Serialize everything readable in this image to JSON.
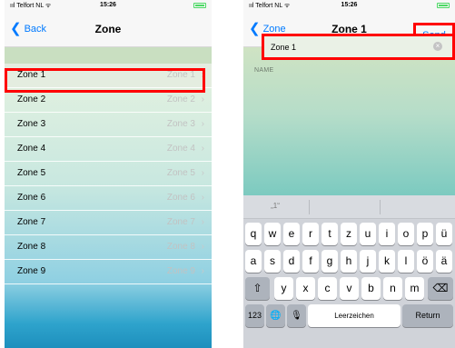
{
  "left_screen": {
    "statusbar": {
      "carrier": "ııl Telfort NL ᯤ",
      "time": "15:26"
    },
    "navbar": {
      "back_label": "Back",
      "title": "Zone"
    },
    "rows": [
      {
        "label": "Zone 1",
        "detail": "Zone 1"
      },
      {
        "label": "Zone 2",
        "detail": "Zone 2"
      },
      {
        "label": "Zone 3",
        "detail": "Zone 3"
      },
      {
        "label": "Zone 4",
        "detail": "Zone 4"
      },
      {
        "label": "Zone 5",
        "detail": "Zone 5"
      },
      {
        "label": "Zone 6",
        "detail": "Zone 6"
      },
      {
        "label": "Zone 7",
        "detail": "Zone 7"
      },
      {
        "label": "Zone 8",
        "detail": "Zone 8"
      },
      {
        "label": "Zone 9",
        "detail": "Zone 9"
      }
    ]
  },
  "right_screen": {
    "statusbar": {
      "carrier": "ııl Telfort NL ᯤ",
      "time": "15:26"
    },
    "navbar": {
      "back_label": "Zone",
      "title": "Zone 1",
      "send_label": "Send"
    },
    "section_label": "NAME",
    "name_value": "Zone 1",
    "keyboard": {
      "suggestion": "„1“",
      "row1": [
        "q",
        "w",
        "e",
        "r",
        "t",
        "z",
        "u",
        "i",
        "o",
        "p",
        "ü"
      ],
      "row2": [
        "a",
        "s",
        "d",
        "f",
        "g",
        "h",
        "j",
        "k",
        "l",
        "ö",
        "ä"
      ],
      "row3": [
        "y",
        "x",
        "c",
        "v",
        "b",
        "n",
        "m"
      ],
      "shift_icon": "⇧",
      "backspace_icon": "⌫",
      "numbers_label": "123",
      "globe_icon": "🌐",
      "mic_icon": "🎙",
      "space_label": "Leerzeichen",
      "return_label": "Return"
    }
  },
  "colors": {
    "accent": "#007aff",
    "highlight": "#ff0000"
  }
}
